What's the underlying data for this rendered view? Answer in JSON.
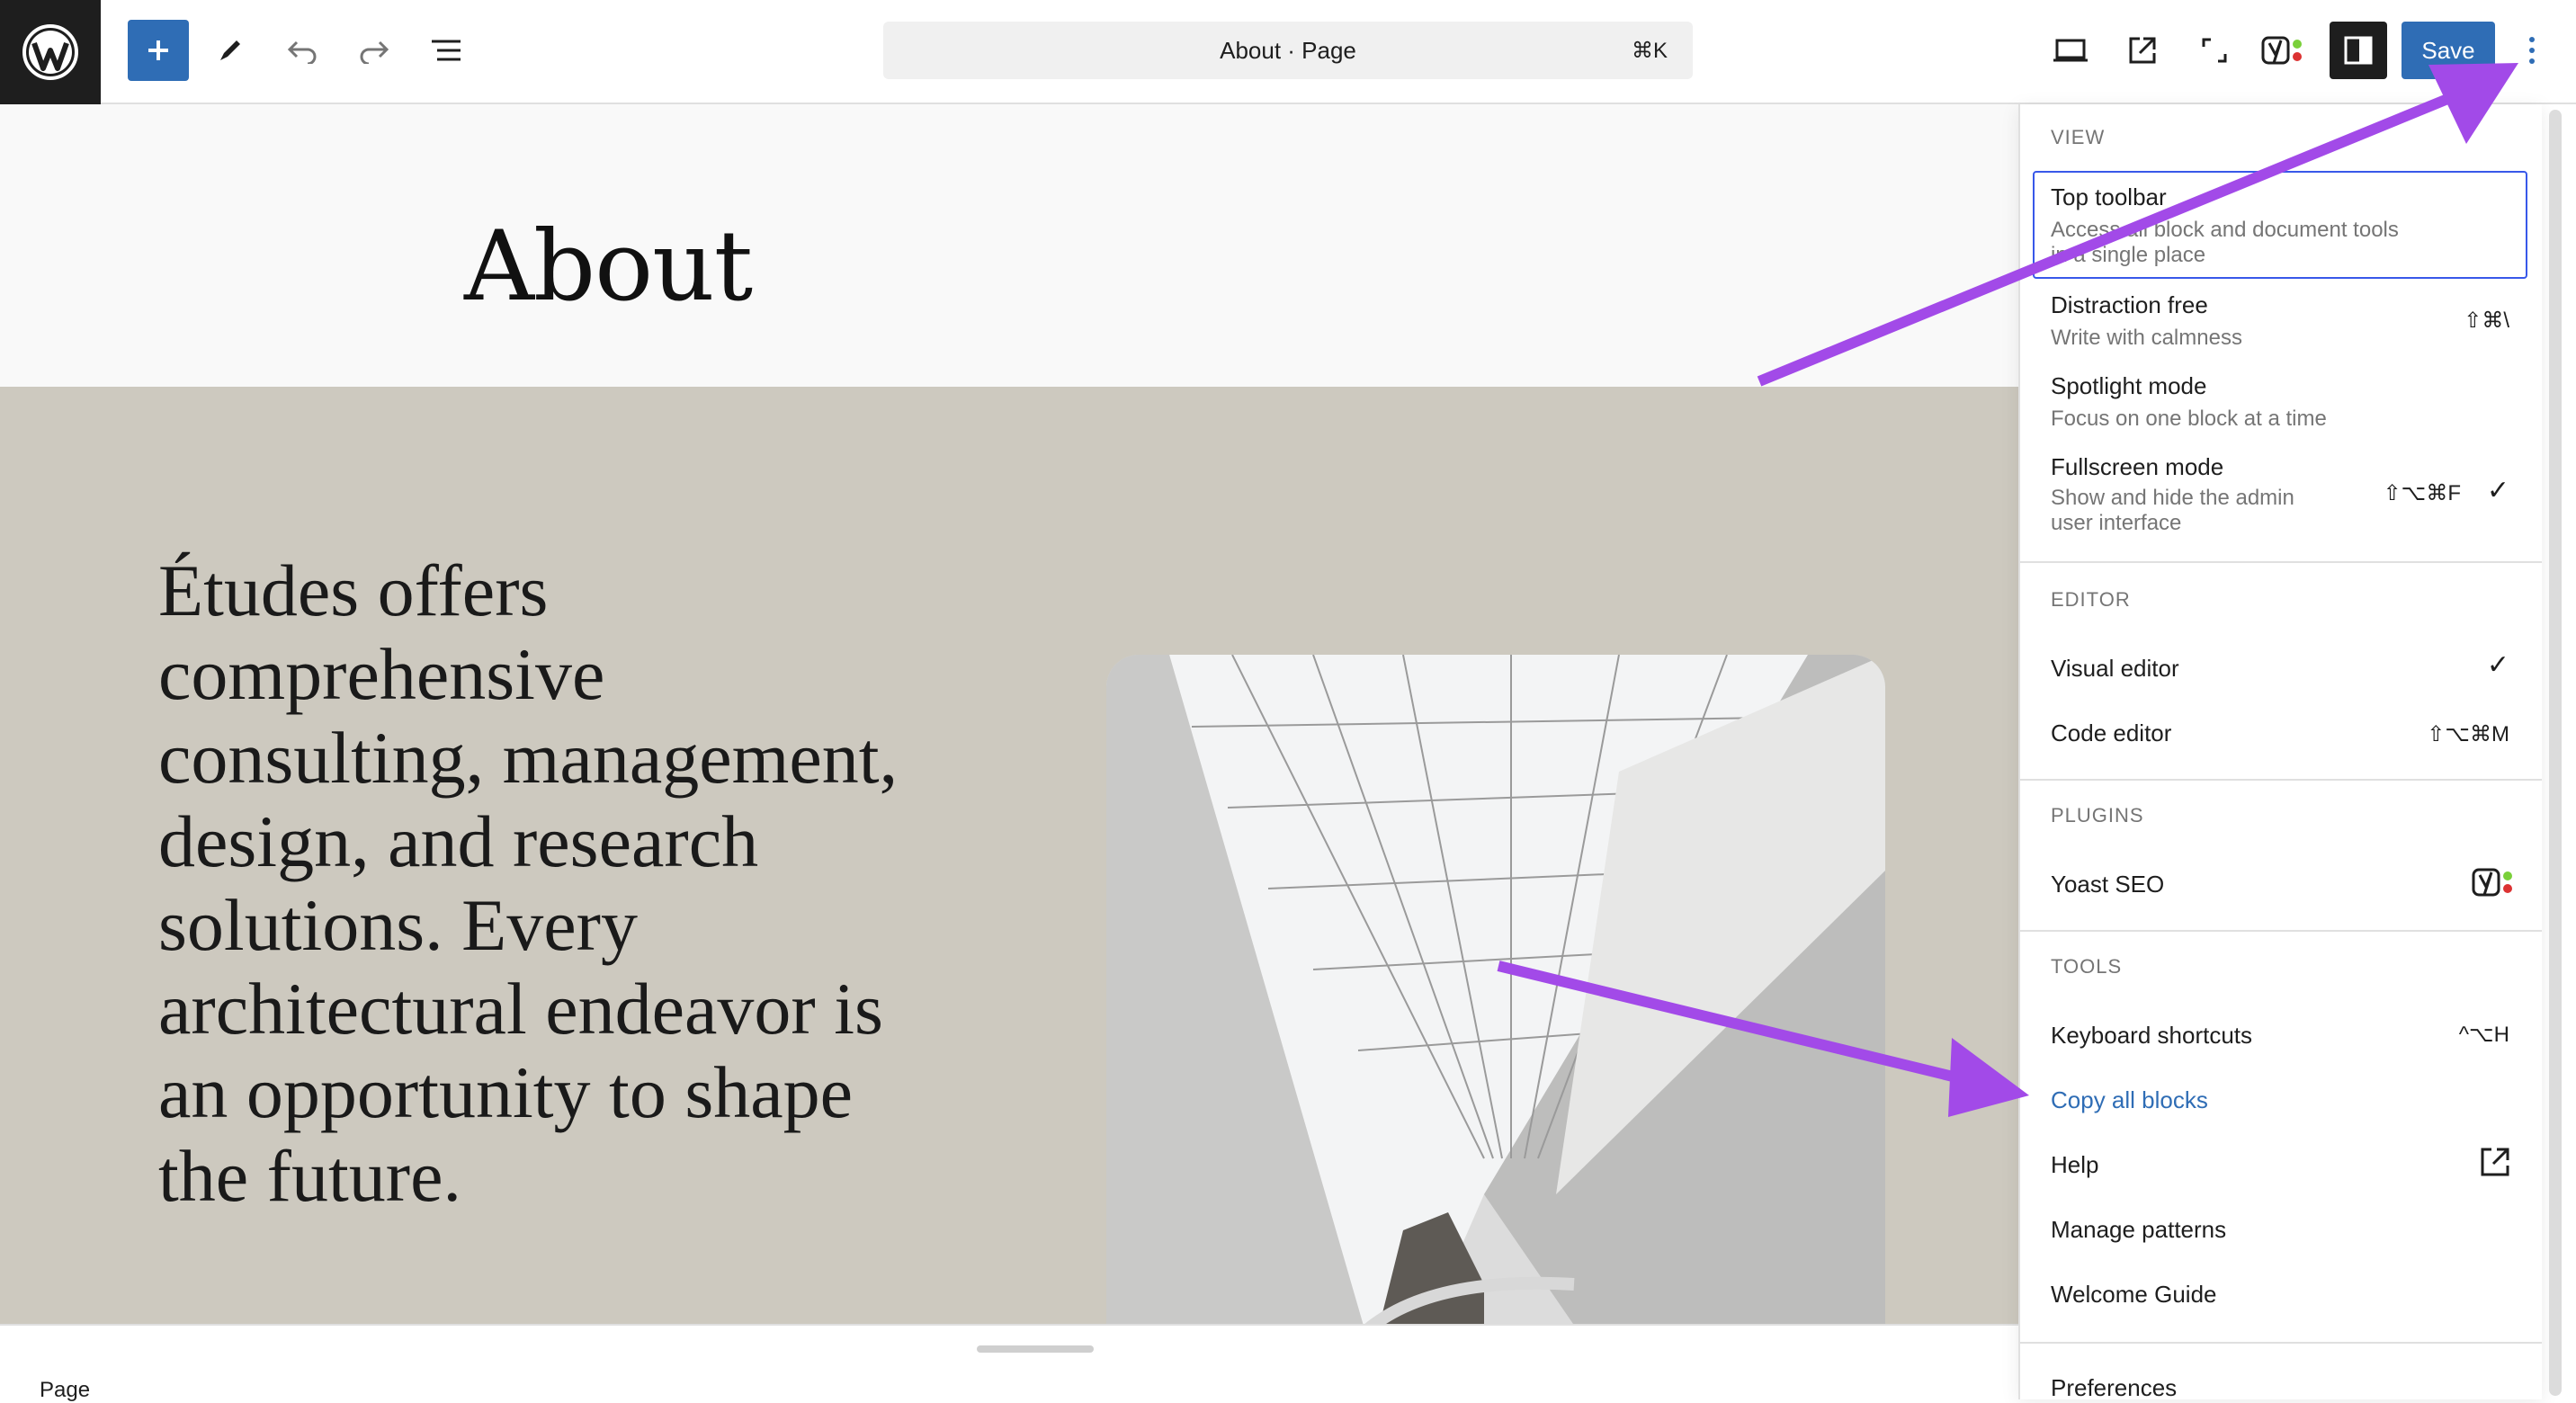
{
  "header": {
    "document_title": "About · Page",
    "command_shortcut": "⌘K",
    "save_label": "Save"
  },
  "editor": {
    "page_title": "About",
    "hero_text": "Études offers comprehensive consulting, management, design, and research solutions. Every architectural endeavor is an opportunity to shape the future."
  },
  "footer": {
    "breadcrumb": "Page"
  },
  "menu": {
    "view": {
      "heading": "VIEW",
      "items": [
        {
          "title": "Top toolbar",
          "desc1": "Access all block and document tools",
          "desc2": "in a single place"
        },
        {
          "title": "Distraction free",
          "desc1": "Write with calmness",
          "shortcut": "⇧⌘\\"
        },
        {
          "title": "Spotlight mode",
          "desc1": "Focus on one block at a time"
        },
        {
          "title": "Fullscreen mode",
          "desc1": "Show and hide the admin",
          "desc2": "user interface",
          "shortcut": "⇧⌥⌘F"
        }
      ]
    },
    "editor": {
      "heading": "EDITOR",
      "items": [
        {
          "title": "Visual editor"
        },
        {
          "title": "Code editor",
          "shortcut": "⇧⌥⌘M"
        }
      ]
    },
    "plugins": {
      "heading": "PLUGINS",
      "items": [
        {
          "title": "Yoast SEO"
        }
      ]
    },
    "tools": {
      "heading": "TOOLS",
      "items": [
        {
          "title": "Keyboard shortcuts",
          "shortcut": "^⌥H"
        },
        {
          "title": "Copy all blocks"
        },
        {
          "title": "Help"
        },
        {
          "title": "Manage patterns"
        },
        {
          "title": "Welcome Guide"
        }
      ]
    },
    "preferences": {
      "title": "Preferences"
    }
  },
  "colors": {
    "accent": "#2f6db5",
    "focus": "#3858e9",
    "annotation_arrow": "#a24ae8",
    "hero_bg": "#cdc9bf"
  },
  "icons": [
    "wordpress-logo-icon",
    "plus-icon",
    "pencil-icon",
    "undo-icon",
    "redo-icon",
    "list-view-icon",
    "desktop-preview-icon",
    "external-link-icon",
    "fullscreen-icon",
    "yoast-icon",
    "sidebar-settings-icon",
    "more-vertical-icon",
    "checkmark-icon"
  ]
}
